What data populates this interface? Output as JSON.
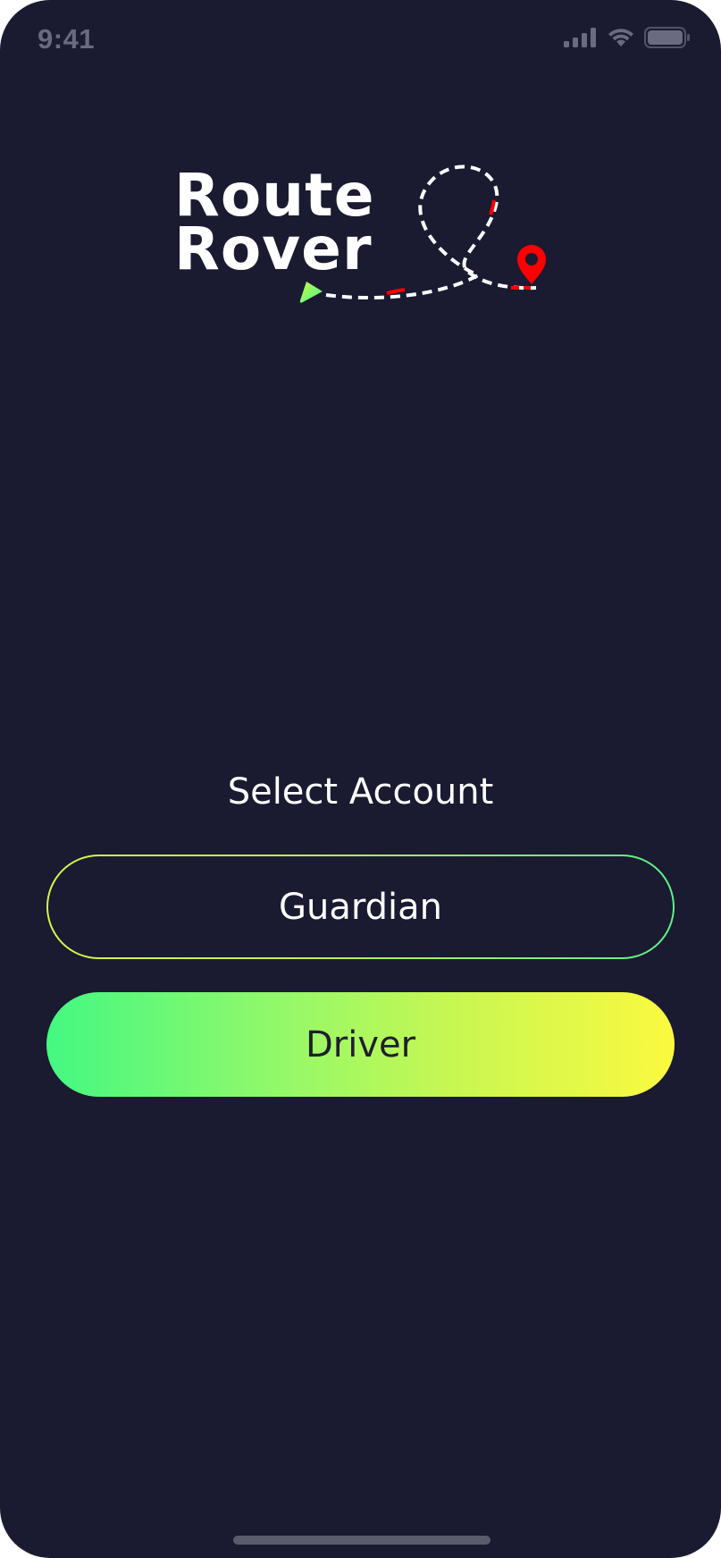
{
  "status_bar": {
    "time": "9:41",
    "icons": [
      "cellular-signal-icon",
      "wifi-icon",
      "battery-icon"
    ]
  },
  "logo": {
    "line1": "Route",
    "line2": "Rover",
    "icons": [
      "start-arrow-icon",
      "location-pin-icon"
    ],
    "colors": {
      "path": "#ffffff",
      "accent_red": "#ff0000",
      "arrow_start": "#c8f752",
      "arrow_end": "#44f882"
    }
  },
  "main": {
    "title": "Select Account",
    "buttons": {
      "guardian_label": "Guardian",
      "driver_label": "Driver"
    }
  },
  "colors": {
    "background": "#1a1a31",
    "gradient_green": "#44f882",
    "gradient_yellow": "#fbf93f",
    "text": "#ffffff"
  }
}
